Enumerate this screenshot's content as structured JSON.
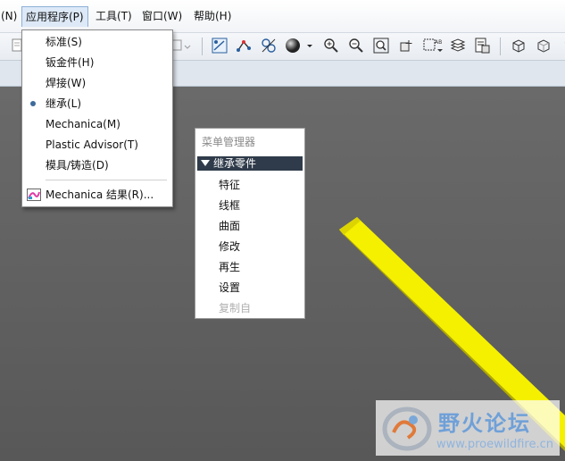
{
  "menubar": {
    "items": [
      {
        "label": "(N)"
      },
      {
        "label": "应用程序(P)"
      },
      {
        "label": "工具(T)"
      },
      {
        "label": "窗口(W)"
      },
      {
        "label": "帮助(H)"
      }
    ]
  },
  "dropdown": {
    "items": [
      {
        "label": "标准(S)"
      },
      {
        "label": "钣金件(H)"
      },
      {
        "label": "焊接(W)"
      },
      {
        "label": "继承(L)",
        "selected": true
      },
      {
        "label": "Mechanica(M)"
      },
      {
        "label": "Plastic Advisor(T)"
      },
      {
        "label": "模具/铸造(D)"
      },
      {
        "label": "Mechanica 结果(R)..."
      }
    ]
  },
  "menu_manager": {
    "title": "菜单管理器",
    "header": "继承零件",
    "items": [
      {
        "label": "特征"
      },
      {
        "label": "线框"
      },
      {
        "label": "曲面"
      },
      {
        "label": "修改"
      },
      {
        "label": "再生"
      },
      {
        "label": "设置"
      },
      {
        "label": "复制自",
        "disabled": true
      }
    ]
  },
  "watermark": {
    "title": "野火论坛",
    "url": "www.proewildfire.cn"
  },
  "colors": {
    "viewport": "#5f5f5f",
    "beam": "#f2f000",
    "menu_header": "#2f3b4a",
    "selected_dot": "#3e6b9a"
  }
}
